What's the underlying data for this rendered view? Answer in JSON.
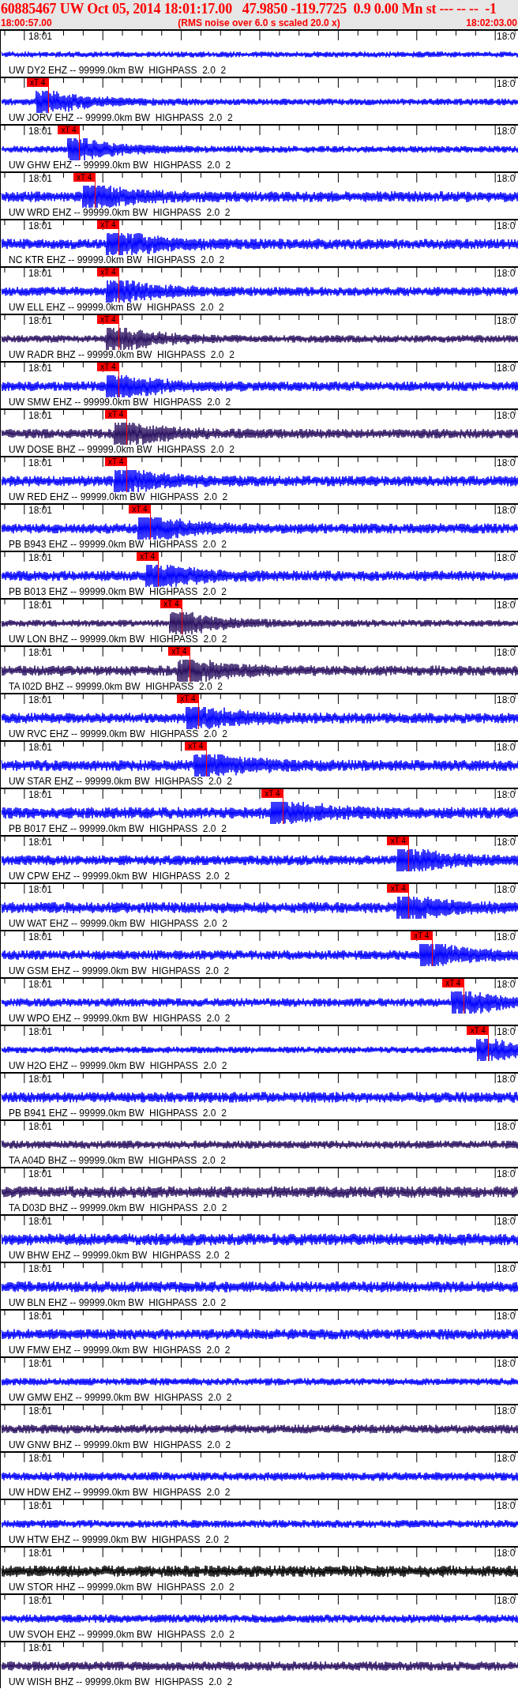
{
  "header": {
    "title": "60885467 UW Oct 05, 2014 18:01:17.00   47.9850 -119.7725  0.9 0.00 Mn st --- -- --  -1",
    "start_time": "18:00:57.00",
    "note": "(RMS noise over 6.0 s scaled 20.0 x)",
    "end_time": "18:02:03.00"
  },
  "traces": [
    {
      "label": "UW DY2 EHZ -- 99999.0km BW  HIGHPASS  2.0  2",
      "time_left": "18:01",
      "time_right": "18:0",
      "color": "#0000ff"
    },
    {
      "label": "UW JORV EHZ -- 99999.0km BW  HIGHPASS  2.0  2",
      "time_right": "18:0",
      "color": "#0000ff",
      "pick": {
        "label": "xT 4",
        "level": 0.091
      }
    },
    {
      "label": "UW GHW EHZ -- 99999.0km BW  HIGHPASS  2.0  2",
      "time_left": "18:01",
      "time_right": "18:0",
      "color": "#0000ff",
      "pick": {
        "label": "xT 4",
        "level": 0.151
      }
    },
    {
      "label": "UW WRD EHZ -- 99999.0km BW  HIGHPASS  2.0  2",
      "time_left": "18:01",
      "time_right": "18:0",
      "color": "#0000ff",
      "pick": {
        "label": "xT 4",
        "level": 0.181
      }
    },
    {
      "label": "NC KTR EHZ -- 99999.0km BW  HIGHPASS  2.0  2",
      "time_left": "18:01",
      "time_right": "18:0",
      "color": "#0000ff",
      "pick": {
        "label": "xT 4",
        "level": 0.227
      }
    },
    {
      "label": "UW ELL EHZ -- 99999.0km BW  HIGHPASS  2.0  2",
      "time_left": "18:01",
      "time_right": "18:0",
      "color": "#0000ff",
      "pick": {
        "label": "xT 4",
        "level": 0.227
      }
    },
    {
      "label": "UW RADR BHZ -- 99999.0km BW  HIGHPASS  2.0  2",
      "time_left": "18:01",
      "time_right": "18:0",
      "color": "#2a1060",
      "pick": {
        "label": "xT 4",
        "level": 0.227
      }
    },
    {
      "label": "UW SMW EHZ -- 99999.0km BW  HIGHPASS  2.0  2",
      "time_left": "18:01",
      "time_right": "18:0",
      "color": "#0000ff",
      "pick": {
        "label": "xT 4",
        "level": 0.227
      }
    },
    {
      "label": "UW DOSE BHZ -- 99999.0km BW  HIGHPASS  2.0  2",
      "time_left": "18:01",
      "time_right": "18:0",
      "color": "#2a1060",
      "pick": {
        "label": "xT 4",
        "level": 0.242
      }
    },
    {
      "label": "UW RED EHZ -- 99999.0km BW  HIGHPASS  2.0  2",
      "time_left": "18:01",
      "time_right": "18:0",
      "color": "#0000ff",
      "pick": {
        "label": "xT 4",
        "level": 0.242
      }
    },
    {
      "label": "PB B943 EHZ -- 99999.0km BW  HIGHPASS  2.0  2",
      "time_left": "18:01",
      "time_right": "18:0",
      "color": "#0000ff",
      "pick": {
        "label": "xT 4",
        "level": 0.288
      }
    },
    {
      "label": "PB B013 EHZ -- 99999.0km BW  HIGHPASS  2.0  2",
      "time_left": "18:01",
      "time_right": "18:0",
      "color": "#0000ff",
      "pick": {
        "label": "xT 4",
        "level": 0.303
      }
    },
    {
      "label": "UW LON BHZ -- 99999.0km BW  HIGHPASS  2.0  2",
      "time_left": "18:01",
      "time_right": "18:0",
      "color": "#2a1060",
      "pick": {
        "label": "xT 4",
        "level": 0.349
      }
    },
    {
      "label": "TA I02D BHZ -- 99999.0km BW  HIGHPASS  2.0  2",
      "time_left": "18:01",
      "time_right": "18:0",
      "color": "#2a1060",
      "pick": {
        "label": "xT 4",
        "level": 0.364
      }
    },
    {
      "label": "UW RVC EHZ -- 99999.0km BW  HIGHPASS  2.0  2",
      "time_left": "18:01",
      "time_right": "18:0",
      "color": "#0000ff",
      "pick": {
        "label": "xT 4",
        "level": 0.381
      }
    },
    {
      "label": "UW STAR EHZ -- 99999.0km BW  HIGHPASS  2.0  2",
      "time_left": "18:01",
      "time_right": "18:0",
      "color": "#0000ff",
      "pick": {
        "label": "xT 4",
        "level": 0.396
      }
    },
    {
      "label": "PB B017 EHZ -- 99999.0km BW  HIGHPASS  2.0  2",
      "time_left": "18:01",
      "time_right": "18:0",
      "color": "#0000ff",
      "pick": {
        "label": "xT 4",
        "level": 0.544
      }
    },
    {
      "label": "UW CPW EHZ -- 99999.0km BW  HIGHPASS  2.0  2",
      "time_left": "18:01",
      "time_right": "18:0",
      "color": "#0000ff",
      "pick": {
        "label": "xT 4",
        "level": 0.787
      }
    },
    {
      "label": "UW WAT EHZ -- 99999.0km BW  HIGHPASS  2.0  2",
      "time_left": "18:01",
      "time_right": "18:0",
      "color": "#0000ff",
      "pick": {
        "label": "xT 4",
        "level": 0.787
      }
    },
    {
      "label": "UW GSM EHZ -- 99999.0km BW  HIGHPASS  2.0  2",
      "time_left": "18:01",
      "time_right": "18:0",
      "color": "#0000ff",
      "pick": {
        "label": "xT 4",
        "level": 0.832
      }
    },
    {
      "label": "UW WPO EHZ -- 99999.0km BW  HIGHPASS  2.0  2",
      "time_left": "18:01",
      "time_right": "18:0",
      "color": "#0000ff",
      "pick": {
        "label": "xT 4",
        "level": 0.893
      }
    },
    {
      "label": "UW H2O EHZ -- 99999.0km BW  HIGHPASS  2.0  2",
      "time_left": "18:01",
      "time_right": "18:0",
      "color": "#0000ff",
      "pick": {
        "label": "xT 4",
        "level": 0.941
      }
    },
    {
      "label": "PB B941 EHZ -- 99999.0km BW  HIGHPASS  2.0  2",
      "time_left": "18:01",
      "time_right": "18:0",
      "color": "#0000ff"
    },
    {
      "label": "TA A04D BHZ -- 99999.0km BW  HIGHPASS  2.0  2",
      "time_left": "18:01",
      "time_right": "18:0",
      "color": "#2a1060"
    },
    {
      "label": "TA D03D BHZ -- 99999.0km BW  HIGHPASS  2.0  2",
      "time_left": "18:01",
      "time_right": "18:0",
      "color": "#2a1060"
    },
    {
      "label": "UW BHW EHZ -- 99999.0km BW  HIGHPASS  2.0  2",
      "time_left": "18:01",
      "time_right": "18:0",
      "color": "#0000ff"
    },
    {
      "label": "UW BLN EHZ -- 99999.0km BW  HIGHPASS  2.0  2",
      "time_left": "18:01",
      "time_right": "18:0",
      "color": "#0000ff"
    },
    {
      "label": "UW FMW EHZ -- 99999.0km BW  HIGHPASS  2.0  2",
      "time_left": "18:01",
      "time_right": "18:0",
      "color": "#0000ff"
    },
    {
      "label": "UW GMW EHZ -- 99999.0km BW  HIGHPASS  2.0  2",
      "time_left": "18:01",
      "time_right": "18:0",
      "color": "#0000ff"
    },
    {
      "label": "UW GNW BHZ -- 99999.0km BW  HIGHPASS  2.0  2",
      "time_left": "18:01",
      "time_right": "18:0",
      "color": "#2a1060"
    },
    {
      "label": "UW HDW EHZ -- 99999.0km BW  HIGHPASS  2.0  2",
      "time_left": "18:01",
      "time_right": "18:0",
      "color": "#0000ff"
    },
    {
      "label": "UW HTW EHZ -- 99999.0km BW  HIGHPASS  2.0  2",
      "time_left": "18:01",
      "time_right": "18:0",
      "color": "#0000ff"
    },
    {
      "label": "UW STOR HHZ -- 99999.0km BW  HIGHPASS  2.0  2",
      "time_left": "18:01",
      "time_right": "18:0",
      "color": "#000000"
    },
    {
      "label": "UW SVOH EHZ -- 99999.0km BW  HIGHPASS  2.0  2",
      "time_left": "18:01",
      "time_right": "18:0",
      "color": "#0000ff"
    },
    {
      "label": "UW WISH BHZ -- 99999.0km BW  HIGHPASS  2.0  2",
      "time_left": "18:01",
      "color": "#2a1060"
    }
  ]
}
